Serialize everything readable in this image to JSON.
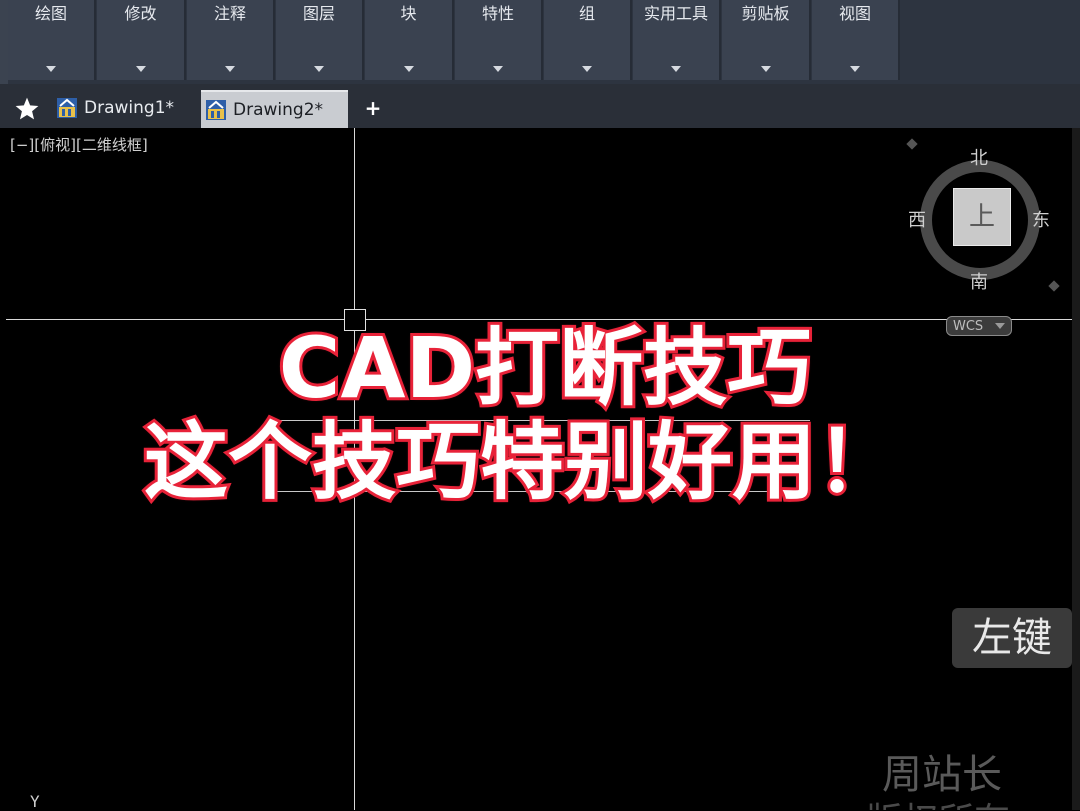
{
  "ribbon": {
    "panels": [
      {
        "label": "绘图"
      },
      {
        "label": "修改"
      },
      {
        "label": "注释"
      },
      {
        "label": "图层"
      },
      {
        "label": "块"
      },
      {
        "label": "特性"
      },
      {
        "label": "组"
      },
      {
        "label": "实用工具"
      },
      {
        "label": "剪贴板"
      },
      {
        "label": "视图"
      }
    ]
  },
  "tabs": {
    "items": [
      {
        "label": "Drawing1*",
        "active": false
      },
      {
        "label": "Drawing2*",
        "active": true
      }
    ],
    "add_label": "+"
  },
  "viewport": {
    "label": "[−][俯视][二维线框]",
    "ucs_axis": "Y"
  },
  "viewcube": {
    "north": "北",
    "south": "南",
    "east": "东",
    "west": "西",
    "face": "上",
    "wcs_label": "WCS"
  },
  "overlay": {
    "line1": "CAD打断技巧",
    "line2": "这个技巧特别好用！"
  },
  "key_hint": "左键",
  "watermark": {
    "line1": "周站长",
    "line2": "版权所有"
  },
  "colors": {
    "overlay_stroke": "#e8243a",
    "ribbon_bg": "#3a4250",
    "viewport_bg": "#000000"
  }
}
